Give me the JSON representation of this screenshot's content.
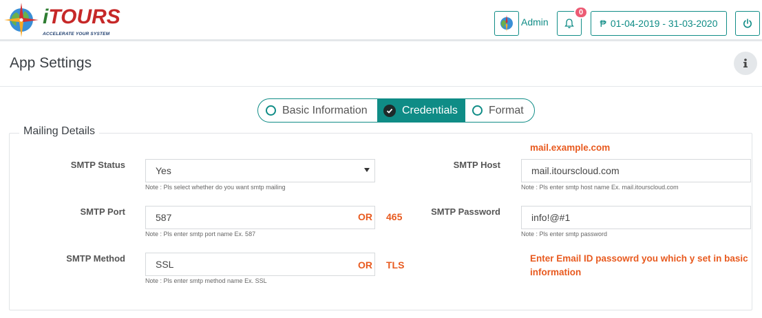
{
  "header": {
    "logo_mark": "i",
    "logo_text": "TOURS",
    "logo_tagline": "ACCELERATE YOUR SYSTEM",
    "admin_label": "Admin",
    "notification_count": "0",
    "date_range_icon": "₱",
    "date_range": "01-04-2019 - 31-03-2020"
  },
  "page": {
    "title": "App Settings"
  },
  "tabs": [
    {
      "label": "Basic Information",
      "state": "unchecked"
    },
    {
      "label": "Credentials",
      "state": "active"
    },
    {
      "label": "Format",
      "state": "unchecked"
    }
  ],
  "mailing": {
    "legend": "Mailing Details",
    "smtp_status": {
      "label": "SMTP Status",
      "value": "Yes",
      "note": "Note : Pls select whether do you want smtp mailing"
    },
    "smtp_port": {
      "label": "SMTP Port",
      "value": "587",
      "note": "Note : Pls enter smtp port name Ex. 587",
      "or": "OR",
      "alt": "465"
    },
    "smtp_method": {
      "label": "SMTP Method",
      "value": "SSL",
      "note": "Note : Pls enter smtp method name Ex. SSL",
      "or": "OR",
      "alt": "TLS"
    },
    "smtp_host": {
      "label": "SMTP Host",
      "value": "mail.itourscloud.com",
      "note": "Note : Pls enter smtp host name Ex. mail.itourscloud.com",
      "hint": "mail.example.com"
    },
    "smtp_password": {
      "label": "SMTP Password",
      "value": "info!@#1",
      "note": "Note : Pls enter smtp password"
    },
    "password_hint": "Enter Email ID passowrd you  which y set in basic information"
  },
  "colors": {
    "accent": "#0f8c86",
    "annotation": "#e85a1f",
    "badge": "#ec5b74"
  }
}
